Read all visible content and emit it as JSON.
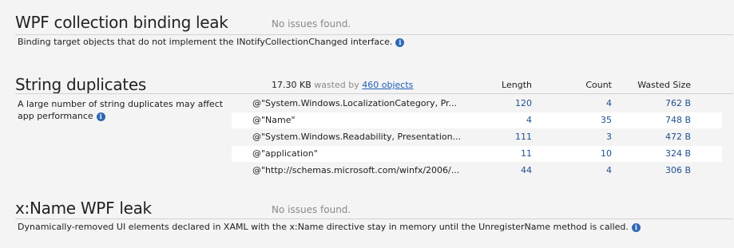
{
  "sections": {
    "wpf_collection": {
      "title": "WPF collection binding leak",
      "status": "No issues found.",
      "description": "Binding target objects that do not implement the INotifyCollectionChanged interface."
    },
    "string_duplicates": {
      "title": "String duplicates",
      "description_line1": "A large number of string duplicates may affect",
      "description_line2": "app performance",
      "summary": {
        "size": "17.30 KB",
        "wasted_by": "wasted by",
        "objects_link": "460 objects"
      },
      "columns": {
        "length": "Length",
        "count": "Count",
        "wasted": "Wasted Size"
      },
      "rows": [
        {
          "string": "@\"System.Windows.LocalizationCategory, Pr...",
          "length": "120",
          "count": "4",
          "wasted": "762 B"
        },
        {
          "string": "@\"Name\"",
          "length": "4",
          "count": "35",
          "wasted": "748 B"
        },
        {
          "string": "@\"System.Windows.Readability, Presentation...",
          "length": "111",
          "count": "3",
          "wasted": "472 B"
        },
        {
          "string": "@\"application\"",
          "length": "11",
          "count": "10",
          "wasted": "324 B"
        },
        {
          "string": "@\"http://schemas.microsoft.com/winfx/2006/...",
          "length": "44",
          "count": "4",
          "wasted": "306 B"
        }
      ]
    },
    "xname_leak": {
      "title": "x:Name WPF leak",
      "status": "No issues found.",
      "description": "Dynamically-removed UI elements declared in XAML with the x:Name directive stay in memory until the UnregisterName method is called."
    }
  },
  "icons": {
    "info": "info-icon",
    "info_glyph": "i"
  },
  "colors": {
    "background": "#f4f4f4",
    "alt_row": "#ffffff",
    "link": "#1f5fb8",
    "number": "#1f4f8f",
    "muted": "#8a8a8a",
    "info_icon": "#2f68b4"
  }
}
